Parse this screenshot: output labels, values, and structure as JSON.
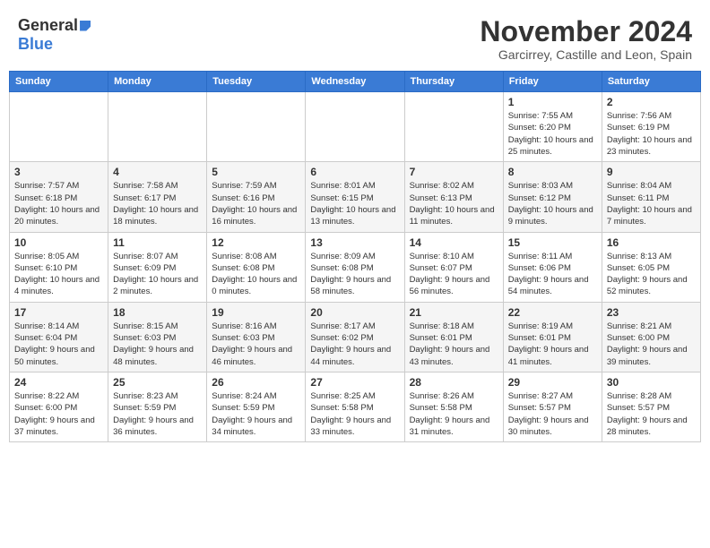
{
  "logo": {
    "general": "General",
    "blue": "Blue"
  },
  "title": "November 2024",
  "subtitle": "Garcirrey, Castille and Leon, Spain",
  "days_header": [
    "Sunday",
    "Monday",
    "Tuesday",
    "Wednesday",
    "Thursday",
    "Friday",
    "Saturday"
  ],
  "weeks": [
    [
      {
        "day": "",
        "info": ""
      },
      {
        "day": "",
        "info": ""
      },
      {
        "day": "",
        "info": ""
      },
      {
        "day": "",
        "info": ""
      },
      {
        "day": "",
        "info": ""
      },
      {
        "day": "1",
        "info": "Sunrise: 7:55 AM\nSunset: 6:20 PM\nDaylight: 10 hours and 25 minutes."
      },
      {
        "day": "2",
        "info": "Sunrise: 7:56 AM\nSunset: 6:19 PM\nDaylight: 10 hours and 23 minutes."
      }
    ],
    [
      {
        "day": "3",
        "info": "Sunrise: 7:57 AM\nSunset: 6:18 PM\nDaylight: 10 hours and 20 minutes."
      },
      {
        "day": "4",
        "info": "Sunrise: 7:58 AM\nSunset: 6:17 PM\nDaylight: 10 hours and 18 minutes."
      },
      {
        "day": "5",
        "info": "Sunrise: 7:59 AM\nSunset: 6:16 PM\nDaylight: 10 hours and 16 minutes."
      },
      {
        "day": "6",
        "info": "Sunrise: 8:01 AM\nSunset: 6:15 PM\nDaylight: 10 hours and 13 minutes."
      },
      {
        "day": "7",
        "info": "Sunrise: 8:02 AM\nSunset: 6:13 PM\nDaylight: 10 hours and 11 minutes."
      },
      {
        "day": "8",
        "info": "Sunrise: 8:03 AM\nSunset: 6:12 PM\nDaylight: 10 hours and 9 minutes."
      },
      {
        "day": "9",
        "info": "Sunrise: 8:04 AM\nSunset: 6:11 PM\nDaylight: 10 hours and 7 minutes."
      }
    ],
    [
      {
        "day": "10",
        "info": "Sunrise: 8:05 AM\nSunset: 6:10 PM\nDaylight: 10 hours and 4 minutes."
      },
      {
        "day": "11",
        "info": "Sunrise: 8:07 AM\nSunset: 6:09 PM\nDaylight: 10 hours and 2 minutes."
      },
      {
        "day": "12",
        "info": "Sunrise: 8:08 AM\nSunset: 6:08 PM\nDaylight: 10 hours and 0 minutes."
      },
      {
        "day": "13",
        "info": "Sunrise: 8:09 AM\nSunset: 6:08 PM\nDaylight: 9 hours and 58 minutes."
      },
      {
        "day": "14",
        "info": "Sunrise: 8:10 AM\nSunset: 6:07 PM\nDaylight: 9 hours and 56 minutes."
      },
      {
        "day": "15",
        "info": "Sunrise: 8:11 AM\nSunset: 6:06 PM\nDaylight: 9 hours and 54 minutes."
      },
      {
        "day": "16",
        "info": "Sunrise: 8:13 AM\nSunset: 6:05 PM\nDaylight: 9 hours and 52 minutes."
      }
    ],
    [
      {
        "day": "17",
        "info": "Sunrise: 8:14 AM\nSunset: 6:04 PM\nDaylight: 9 hours and 50 minutes."
      },
      {
        "day": "18",
        "info": "Sunrise: 8:15 AM\nSunset: 6:03 PM\nDaylight: 9 hours and 48 minutes."
      },
      {
        "day": "19",
        "info": "Sunrise: 8:16 AM\nSunset: 6:03 PM\nDaylight: 9 hours and 46 minutes."
      },
      {
        "day": "20",
        "info": "Sunrise: 8:17 AM\nSunset: 6:02 PM\nDaylight: 9 hours and 44 minutes."
      },
      {
        "day": "21",
        "info": "Sunrise: 8:18 AM\nSunset: 6:01 PM\nDaylight: 9 hours and 43 minutes."
      },
      {
        "day": "22",
        "info": "Sunrise: 8:19 AM\nSunset: 6:01 PM\nDaylight: 9 hours and 41 minutes."
      },
      {
        "day": "23",
        "info": "Sunrise: 8:21 AM\nSunset: 6:00 PM\nDaylight: 9 hours and 39 minutes."
      }
    ],
    [
      {
        "day": "24",
        "info": "Sunrise: 8:22 AM\nSunset: 6:00 PM\nDaylight: 9 hours and 37 minutes."
      },
      {
        "day": "25",
        "info": "Sunrise: 8:23 AM\nSunset: 5:59 PM\nDaylight: 9 hours and 36 minutes."
      },
      {
        "day": "26",
        "info": "Sunrise: 8:24 AM\nSunset: 5:59 PM\nDaylight: 9 hours and 34 minutes."
      },
      {
        "day": "27",
        "info": "Sunrise: 8:25 AM\nSunset: 5:58 PM\nDaylight: 9 hours and 33 minutes."
      },
      {
        "day": "28",
        "info": "Sunrise: 8:26 AM\nSunset: 5:58 PM\nDaylight: 9 hours and 31 minutes."
      },
      {
        "day": "29",
        "info": "Sunrise: 8:27 AM\nSunset: 5:57 PM\nDaylight: 9 hours and 30 minutes."
      },
      {
        "day": "30",
        "info": "Sunrise: 8:28 AM\nSunset: 5:57 PM\nDaylight: 9 hours and 28 minutes."
      }
    ]
  ]
}
